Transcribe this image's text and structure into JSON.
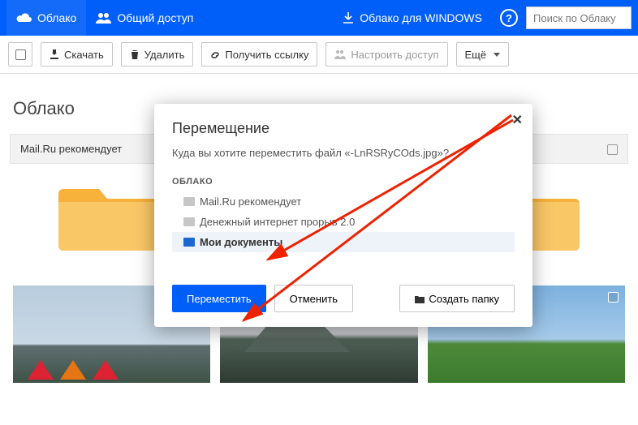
{
  "topbar": {
    "cloud": "Облако",
    "shared": "Общий доступ",
    "windows": "Облако для WINDOWS",
    "help": "?"
  },
  "search": {
    "placeholder": "Поиск по Облаку"
  },
  "toolbar": {
    "download": "Скачать",
    "delete": "Удалить",
    "link": "Получить ссылку",
    "access": "Настроить доступ",
    "more": "Ещё"
  },
  "page": {
    "title": "Облако"
  },
  "recommend": {
    "label": "Mail.Ru рекомендует"
  },
  "modal": {
    "title": "Перемещение",
    "prompt": "Куда вы хотите переместить файл «-LnRSRyCOds.jpg»?",
    "tree_head": "ОБЛАКО",
    "items": {
      "0": {
        "label": "Mail.Ru рекомендует"
      },
      "1": {
        "label": "Денежный интернет прорыв 2.0"
      },
      "2": {
        "label": "Мои документы"
      }
    },
    "move": "Переместить",
    "cancel": "Отменить",
    "new_folder": "Создать папку"
  }
}
